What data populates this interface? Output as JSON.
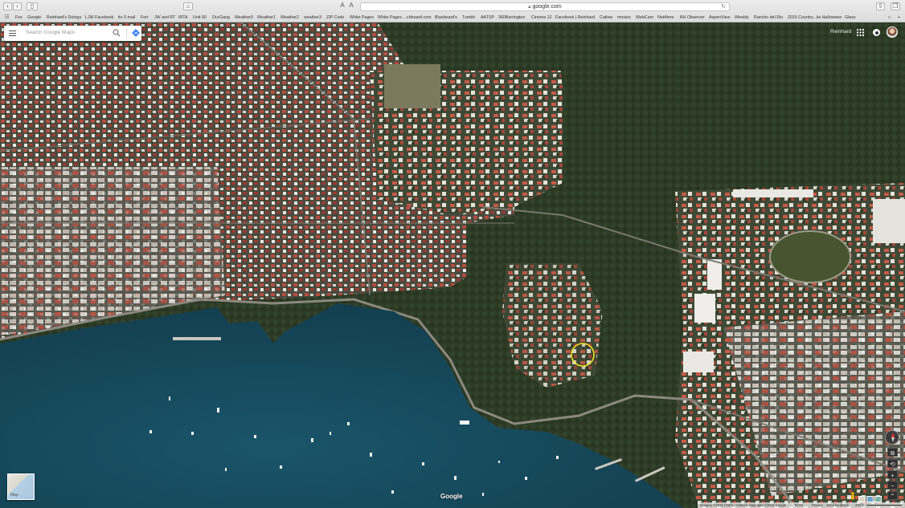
{
  "browser": {
    "url": "google.com",
    "bookmarks": [
      "Fox",
      "Google",
      "Reinhard's Doings",
      "LJW Facebook",
      "itv-3 mail",
      "Fort",
      "JW and RT",
      "IRTA",
      "Unit 90",
      "OurGang",
      "Weather0",
      "Weather1",
      "Weather2",
      "weather3",
      "ZIP Code",
      "White Pages",
      "White Pages ...chboard.com",
      "Bluebeard's",
      "Tumblr",
      "AATSP",
      "360Barrington",
      "Cinema 12",
      "Facebook | Reinhard",
      "Catlow",
      "movies",
      "WebCam",
      "NetAtmo",
      "BH Observer",
      "AspenView",
      "Weebly",
      "Rancho del Rio",
      "2015 Country...ks Halloween",
      "Glass"
    ]
  },
  "search": {
    "placeholder": "Search Google Maps"
  },
  "header": {
    "user_name": "Reinhard"
  },
  "map": {
    "type_toggle_label": "Map",
    "watermark": "Google",
    "footer": {
      "imagery": "Imagery ©2015 CNES / Astrium, Map data ©2015 Google",
      "terms": "Terms",
      "privacy": "Privacy",
      "feedback": "Send feedback",
      "scale": "200 ft"
    },
    "colors": {
      "water": "#164a5e",
      "land": "#2f3b2c",
      "highlight": "#f4e11a"
    }
  },
  "icons": [
    "back-icon",
    "forward-icon",
    "sidebar-icon",
    "home-icon",
    "share-icon",
    "tabs-icon",
    "menu-icon",
    "search-icon",
    "directions-icon",
    "apps-icon",
    "notifications-icon",
    "compass-icon",
    "zoom-in-icon",
    "zoom-out-icon",
    "pegman-icon"
  ]
}
